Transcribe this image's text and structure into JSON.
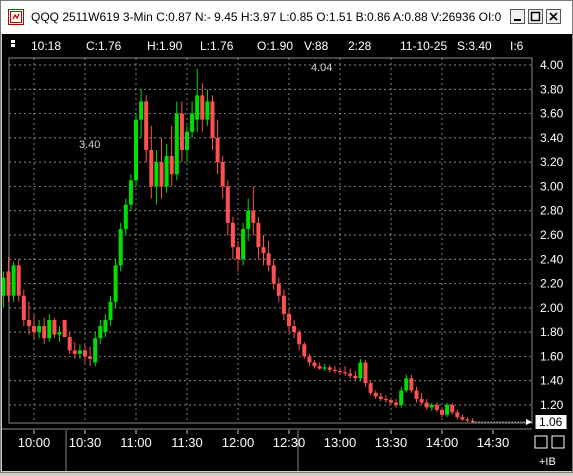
{
  "window": {
    "title": "QQQ 2511W619 3-Min C:0.87 N:- 9.45 H:3.97 L:0.85 O:1.51 B:0.86 A:0.88 V:26936 OI:0",
    "app_icon": "chart-app-icon",
    "controls": [
      "minimize-icon",
      "maximize-icon",
      "close-icon"
    ]
  },
  "infobar": {
    "time": "10:18",
    "close": "C:1.76",
    "high": "H:1.90",
    "low": "L:1.76",
    "open": "O:1.90",
    "volume": "V:88",
    "bar_index": "2:28",
    "date": "11-10-25",
    "strike": "S:3.40",
    "interval": "I:6"
  },
  "annotations": {
    "peak_label": "4.04",
    "level_label": "3.40"
  },
  "last_price_label": "1.06",
  "footer": {
    "plus_ib_label": "+IB"
  },
  "colors": {
    "up": "#00e000",
    "down": "#ff5050",
    "background": "#000000",
    "grid": "#b8b8b8",
    "axis_text": "#ffffff"
  },
  "chart_data": {
    "type": "candlestick",
    "ylim": [
      1.06,
      4.0
    ],
    "y_ticks": [
      "4.00",
      "3.80",
      "3.60",
      "3.40",
      "3.20",
      "3.00",
      "2.80",
      "2.60",
      "2.40",
      "2.20",
      "2.00",
      "1.80",
      "1.60",
      "1.40",
      "1.20",
      "1.06"
    ],
    "x_ticks": [
      "10:00",
      "10:30",
      "11:00",
      "11:30",
      "12:00",
      "12:30",
      "13:00",
      "13:30",
      "14:00",
      "14:30"
    ],
    "x_range": [
      "09:42",
      "15:00"
    ],
    "grid": true,
    "bar_interval_minutes": 3,
    "candles": [
      {
        "t": "09:42",
        "o": 2.1,
        "h": 2.3,
        "l": 2.0,
        "c": 2.25
      },
      {
        "t": "09:45",
        "o": 2.3,
        "h": 2.42,
        "l": 2.05,
        "c": 2.1
      },
      {
        "t": "09:48",
        "o": 2.1,
        "h": 2.38,
        "l": 2.05,
        "c": 2.35
      },
      {
        "t": "09:51",
        "o": 2.35,
        "h": 2.4,
        "l": 2.05,
        "c": 2.1
      },
      {
        "t": "09:54",
        "o": 2.1,
        "h": 2.15,
        "l": 1.85,
        "c": 1.9
      },
      {
        "t": "09:57",
        "o": 1.9,
        "h": 2.05,
        "l": 1.78,
        "c": 1.85
      },
      {
        "t": "10:00",
        "o": 1.85,
        "h": 1.95,
        "l": 1.75,
        "c": 1.8
      },
      {
        "t": "10:03",
        "o": 1.8,
        "h": 1.9,
        "l": 1.75,
        "c": 1.85
      },
      {
        "t": "10:06",
        "o": 1.85,
        "h": 1.92,
        "l": 1.7,
        "c": 1.75
      },
      {
        "t": "10:09",
        "o": 1.75,
        "h": 1.95,
        "l": 1.72,
        "c": 1.9
      },
      {
        "t": "10:12",
        "o": 1.9,
        "h": 1.92,
        "l": 1.75,
        "c": 1.78
      },
      {
        "t": "10:15",
        "o": 1.78,
        "h": 1.85,
        "l": 1.72,
        "c": 1.8
      },
      {
        "t": "10:18",
        "o": 1.9,
        "h": 1.9,
        "l": 1.76,
        "c": 1.76
      },
      {
        "t": "10:21",
        "o": 1.76,
        "h": 1.8,
        "l": 1.62,
        "c": 1.65
      },
      {
        "t": "10:24",
        "o": 1.65,
        "h": 1.72,
        "l": 1.58,
        "c": 1.62
      },
      {
        "t": "10:27",
        "o": 1.62,
        "h": 1.7,
        "l": 1.58,
        "c": 1.65
      },
      {
        "t": "10:30",
        "o": 1.65,
        "h": 1.7,
        "l": 1.55,
        "c": 1.6
      },
      {
        "t": "10:33",
        "o": 1.6,
        "h": 1.68,
        "l": 1.52,
        "c": 1.58
      },
      {
        "t": "10:36",
        "o": 1.55,
        "h": 1.8,
        "l": 1.52,
        "c": 1.75
      },
      {
        "t": "10:39",
        "o": 1.75,
        "h": 1.9,
        "l": 1.7,
        "c": 1.85
      },
      {
        "t": "10:42",
        "o": 1.8,
        "h": 1.95,
        "l": 1.76,
        "c": 1.9
      },
      {
        "t": "10:45",
        "o": 1.9,
        "h": 2.1,
        "l": 1.85,
        "c": 2.05
      },
      {
        "t": "10:48",
        "o": 2.05,
        "h": 2.4,
        "l": 2.0,
        "c": 2.35
      },
      {
        "t": "10:51",
        "o": 2.35,
        "h": 2.7,
        "l": 2.3,
        "c": 2.65
      },
      {
        "t": "10:54",
        "o": 2.65,
        "h": 2.9,
        "l": 2.6,
        "c": 2.85
      },
      {
        "t": "10:57",
        "o": 2.85,
        "h": 3.1,
        "l": 2.8,
        "c": 3.05
      },
      {
        "t": "11:00",
        "o": 3.05,
        "h": 3.6,
        "l": 3.0,
        "c": 3.55
      },
      {
        "t": "11:03",
        "o": 3.55,
        "h": 3.8,
        "l": 3.4,
        "c": 3.7
      },
      {
        "t": "11:06",
        "o": 3.7,
        "h": 3.75,
        "l": 3.2,
        "c": 3.3
      },
      {
        "t": "11:09",
        "o": 3.3,
        "h": 3.5,
        "l": 2.9,
        "c": 3.0
      },
      {
        "t": "11:12",
        "o": 3.0,
        "h": 3.3,
        "l": 2.85,
        "c": 3.2
      },
      {
        "t": "11:15",
        "o": 3.2,
        "h": 3.4,
        "l": 2.9,
        "c": 3.0
      },
      {
        "t": "11:18",
        "o": 3.0,
        "h": 3.35,
        "l": 2.95,
        "c": 3.25
      },
      {
        "t": "11:21",
        "o": 3.25,
        "h": 3.5,
        "l": 3.0,
        "c": 3.1
      },
      {
        "t": "11:24",
        "o": 3.1,
        "h": 3.7,
        "l": 3.05,
        "c": 3.6
      },
      {
        "t": "11:27",
        "o": 3.6,
        "h": 3.7,
        "l": 3.2,
        "c": 3.3
      },
      {
        "t": "11:30",
        "o": 3.3,
        "h": 3.5,
        "l": 3.2,
        "c": 3.45
      },
      {
        "t": "11:33",
        "o": 3.45,
        "h": 3.7,
        "l": 3.4,
        "c": 3.6
      },
      {
        "t": "11:36",
        "o": 3.55,
        "h": 3.97,
        "l": 3.45,
        "c": 3.75
      },
      {
        "t": "11:39",
        "o": 3.75,
        "h": 3.85,
        "l": 3.45,
        "c": 3.55
      },
      {
        "t": "11:42",
        "o": 3.55,
        "h": 3.8,
        "l": 3.5,
        "c": 3.7
      },
      {
        "t": "11:45",
        "o": 3.7,
        "h": 3.75,
        "l": 3.3,
        "c": 3.4
      },
      {
        "t": "11:48",
        "o": 3.4,
        "h": 3.55,
        "l": 3.1,
        "c": 3.2
      },
      {
        "t": "11:51",
        "o": 3.2,
        "h": 3.25,
        "l": 2.9,
        "c": 3.0
      },
      {
        "t": "11:54",
        "o": 3.0,
        "h": 3.05,
        "l": 2.6,
        "c": 2.7
      },
      {
        "t": "11:57",
        "o": 2.7,
        "h": 2.75,
        "l": 2.4,
        "c": 2.5
      },
      {
        "t": "12:00",
        "o": 2.5,
        "h": 2.55,
        "l": 2.3,
        "c": 2.4
      },
      {
        "t": "12:03",
        "o": 2.4,
        "h": 2.7,
        "l": 2.35,
        "c": 2.65
      },
      {
        "t": "12:06",
        "o": 2.65,
        "h": 2.9,
        "l": 2.55,
        "c": 2.8
      },
      {
        "t": "12:09",
        "o": 2.8,
        "h": 3.0,
        "l": 2.6,
        "c": 2.7
      },
      {
        "t": "12:12",
        "o": 2.7,
        "h": 2.75,
        "l": 2.4,
        "c": 2.5
      },
      {
        "t": "12:15",
        "o": 2.5,
        "h": 2.6,
        "l": 2.35,
        "c": 2.45
      },
      {
        "t": "12:18",
        "o": 2.45,
        "h": 2.55,
        "l": 2.3,
        "c": 2.35
      },
      {
        "t": "12:21",
        "o": 2.35,
        "h": 2.4,
        "l": 2.15,
        "c": 2.2
      },
      {
        "t": "12:24",
        "o": 2.2,
        "h": 2.25,
        "l": 2.05,
        "c": 2.1
      },
      {
        "t": "12:27",
        "o": 2.1,
        "h": 2.15,
        "l": 1.9,
        "c": 1.95
      },
      {
        "t": "12:30",
        "o": 1.95,
        "h": 2.0,
        "l": 1.8,
        "c": 1.85
      },
      {
        "t": "12:33",
        "o": 1.85,
        "h": 1.9,
        "l": 1.75,
        "c": 1.8
      },
      {
        "t": "12:36",
        "o": 1.8,
        "h": 1.82,
        "l": 1.65,
        "c": 1.7
      },
      {
        "t": "12:39",
        "o": 1.7,
        "h": 1.72,
        "l": 1.58,
        "c": 1.6
      },
      {
        "t": "12:42",
        "o": 1.6,
        "h": 1.62,
        "l": 1.52,
        "c": 1.55
      },
      {
        "t": "12:45",
        "o": 1.55,
        "h": 1.57,
        "l": 1.5,
        "c": 1.52
      },
      {
        "t": "12:48",
        "o": 1.52,
        "h": 1.55,
        "l": 1.49,
        "c": 1.5
      },
      {
        "t": "12:51",
        "o": 1.5,
        "h": 1.54,
        "l": 1.48,
        "c": 1.51
      },
      {
        "t": "12:54",
        "o": 1.51,
        "h": 1.53,
        "l": 1.47,
        "c": 1.49
      },
      {
        "t": "12:57",
        "o": 1.49,
        "h": 1.52,
        "l": 1.46,
        "c": 1.48
      },
      {
        "t": "13:00",
        "o": 1.48,
        "h": 1.51,
        "l": 1.45,
        "c": 1.47
      },
      {
        "t": "13:03",
        "o": 1.47,
        "h": 1.52,
        "l": 1.44,
        "c": 1.46
      },
      {
        "t": "13:06",
        "o": 1.46,
        "h": 1.5,
        "l": 1.42,
        "c": 1.44
      },
      {
        "t": "13:09",
        "o": 1.44,
        "h": 1.48,
        "l": 1.4,
        "c": 1.42
      },
      {
        "t": "13:12",
        "o": 1.42,
        "h": 1.58,
        "l": 1.4,
        "c": 1.55
      },
      {
        "t": "13:15",
        "o": 1.55,
        "h": 1.57,
        "l": 1.35,
        "c": 1.38
      },
      {
        "t": "13:18",
        "o": 1.38,
        "h": 1.4,
        "l": 1.28,
        "c": 1.3
      },
      {
        "t": "13:21",
        "o": 1.3,
        "h": 1.32,
        "l": 1.25,
        "c": 1.27
      },
      {
        "t": "13:24",
        "o": 1.27,
        "h": 1.3,
        "l": 1.23,
        "c": 1.25
      },
      {
        "t": "13:27",
        "o": 1.25,
        "h": 1.28,
        "l": 1.22,
        "c": 1.24
      },
      {
        "t": "13:30",
        "o": 1.24,
        "h": 1.26,
        "l": 1.2,
        "c": 1.22
      },
      {
        "t": "13:33",
        "o": 1.22,
        "h": 1.25,
        "l": 1.18,
        "c": 1.2
      },
      {
        "t": "13:36",
        "o": 1.2,
        "h": 1.35,
        "l": 1.18,
        "c": 1.32
      },
      {
        "t": "13:39",
        "o": 1.32,
        "h": 1.45,
        "l": 1.3,
        "c": 1.42
      },
      {
        "t": "13:42",
        "o": 1.42,
        "h": 1.45,
        "l": 1.3,
        "c": 1.32
      },
      {
        "t": "13:45",
        "o": 1.32,
        "h": 1.35,
        "l": 1.22,
        "c": 1.25
      },
      {
        "t": "13:48",
        "o": 1.25,
        "h": 1.3,
        "l": 1.2,
        "c": 1.22
      },
      {
        "t": "13:51",
        "o": 1.22,
        "h": 1.25,
        "l": 1.16,
        "c": 1.18
      },
      {
        "t": "13:54",
        "o": 1.18,
        "h": 1.22,
        "l": 1.15,
        "c": 1.2
      },
      {
        "t": "13:57",
        "o": 1.2,
        "h": 1.22,
        "l": 1.14,
        "c": 1.16
      },
      {
        "t": "14:00",
        "o": 1.16,
        "h": 1.18,
        "l": 1.1,
        "c": 1.12
      },
      {
        "t": "14:03",
        "o": 1.12,
        "h": 1.22,
        "l": 1.1,
        "c": 1.2
      },
      {
        "t": "14:06",
        "o": 1.2,
        "h": 1.22,
        "l": 1.12,
        "c": 1.14
      },
      {
        "t": "14:09",
        "o": 1.14,
        "h": 1.16,
        "l": 1.08,
        "c": 1.1
      },
      {
        "t": "14:12",
        "o": 1.1,
        "h": 1.12,
        "l": 1.07,
        "c": 1.08
      },
      {
        "t": "14:15",
        "o": 1.08,
        "h": 1.1,
        "l": 1.06,
        "c": 1.07
      },
      {
        "t": "14:18",
        "o": 1.07,
        "h": 1.09,
        "l": 1.06,
        "c": 1.06
      }
    ]
  }
}
